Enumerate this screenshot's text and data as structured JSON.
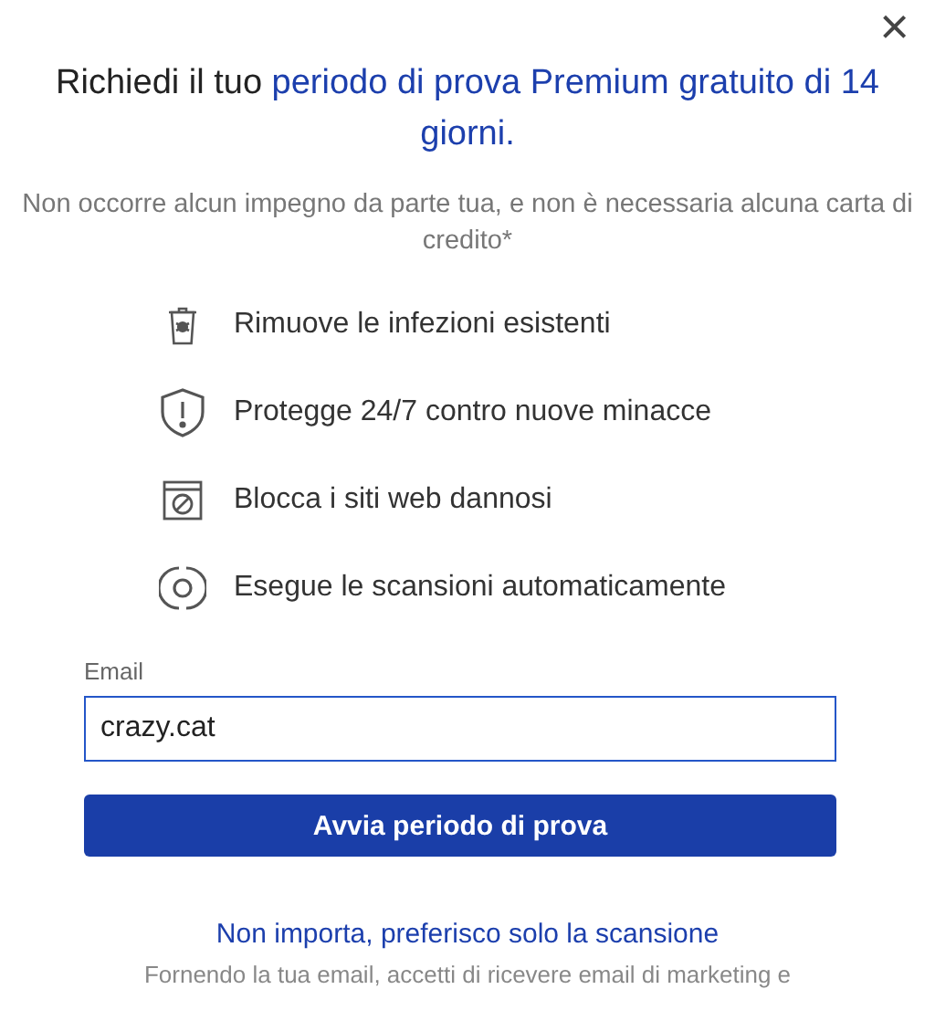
{
  "close_label": "×",
  "title": {
    "lead": "Richiedi il tuo ",
    "highlight": "periodo di prova Premium gratuito di 14 giorni."
  },
  "subtitle": "Non occorre alcun impegno da parte tua, e non è necessaria alcuna carta di credito*",
  "features": [
    {
      "kind": "bug",
      "text": "Rimuove le infezioni esistenti"
    },
    {
      "kind": "shield",
      "text": "Protegge 24/7 contro nuove minacce"
    },
    {
      "kind": "block",
      "text": "Blocca i siti web dannosi"
    },
    {
      "kind": "scan",
      "text": "Esegue le scansioni automaticamente"
    }
  ],
  "email": {
    "label": "Email",
    "value": "crazy.cat"
  },
  "start_button": "Avvia periodo di prova",
  "skip_link": "Non importa, preferisco solo la scansione",
  "footer": "Fornendo la tua email, accetti di ricevere email di marketing e"
}
